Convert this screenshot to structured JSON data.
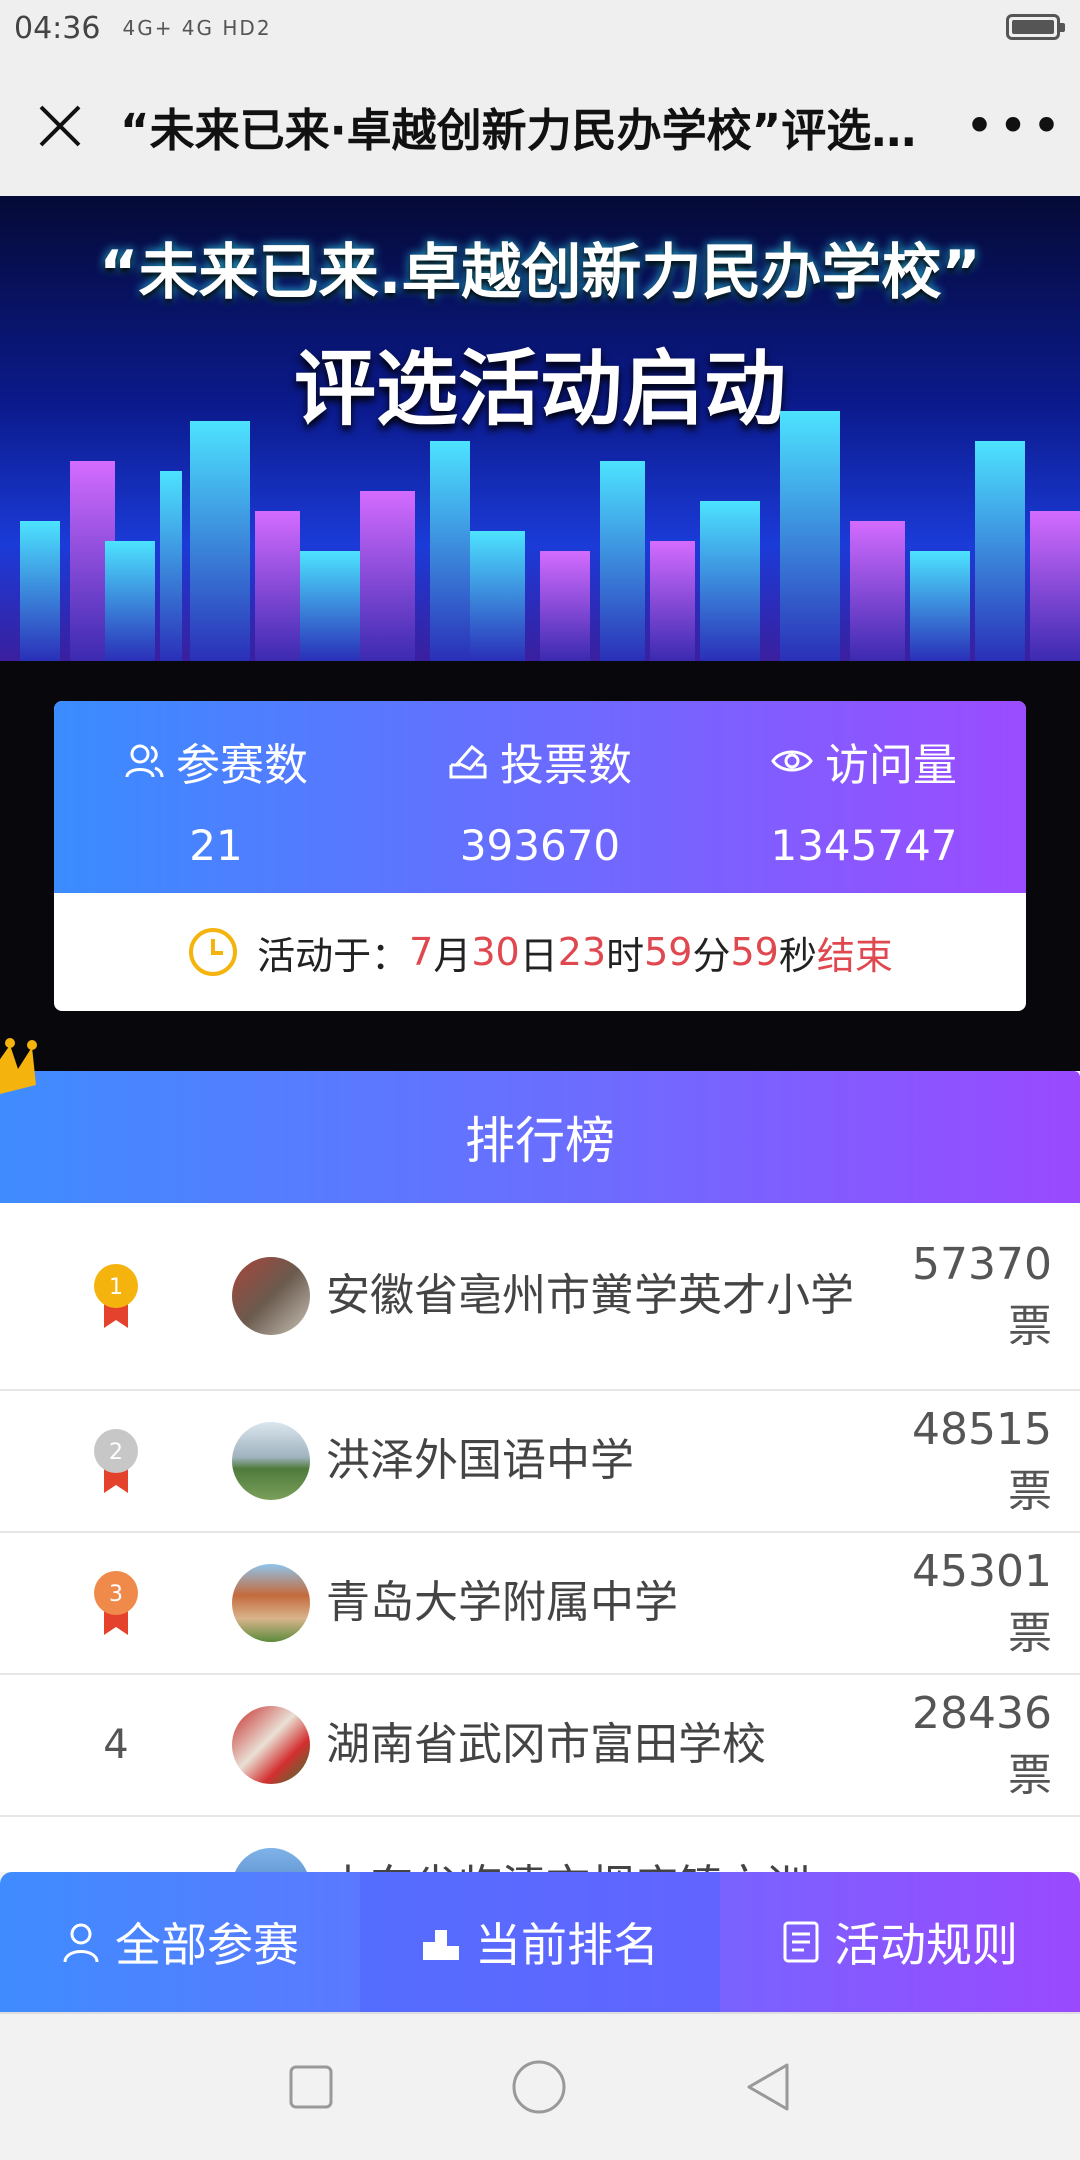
{
  "status_bar": {
    "time": "04:36",
    "network": "4G+ 4G HD2"
  },
  "title_bar": {
    "title": "“未来已来·卓越创新力民办学校”评选活动启动"
  },
  "banner": {
    "title": "“未来已来.卓越创新力民办学校”",
    "subtitle": "评选活动启动"
  },
  "stats": {
    "participants_label": "参赛数",
    "participants": "21",
    "votes_label": "投票数",
    "votes": "393670",
    "visits_label": "访问量",
    "visits": "1345747"
  },
  "countdown": {
    "prefix": "活动于：",
    "month": "7",
    "month_unit": "月",
    "day": "30",
    "day_unit": "日",
    "hour": "23",
    "hour_unit": "时",
    "minute": "59",
    "minute_unit": "分",
    "second": "59",
    "second_unit": "秒",
    "suffix": "结束"
  },
  "ranking": {
    "header": "排行榜",
    "rows": [
      {
        "rank": "1",
        "name": "安徽省亳州市黉学英才小学",
        "votes": "57370票"
      },
      {
        "rank": "2",
        "name": "洪泽外国语中学",
        "votes": "48515票"
      },
      {
        "rank": "3",
        "name": "青岛大学附属中学",
        "votes": "45301票"
      },
      {
        "rank": "4",
        "name": "湖南省武冈市富田学校",
        "votes": "28436票"
      },
      {
        "rank": "",
        "name": "山东省临清市烟店镇文训",
        "votes": ""
      }
    ]
  },
  "bottom_nav": {
    "all": "全部参赛",
    "ranking": "当前排名",
    "rules": "活动规则"
  },
  "colors": {
    "accent_blue": "#3f8cff",
    "accent_purple": "#9a49ff",
    "countdown_red": "#e0484f"
  }
}
